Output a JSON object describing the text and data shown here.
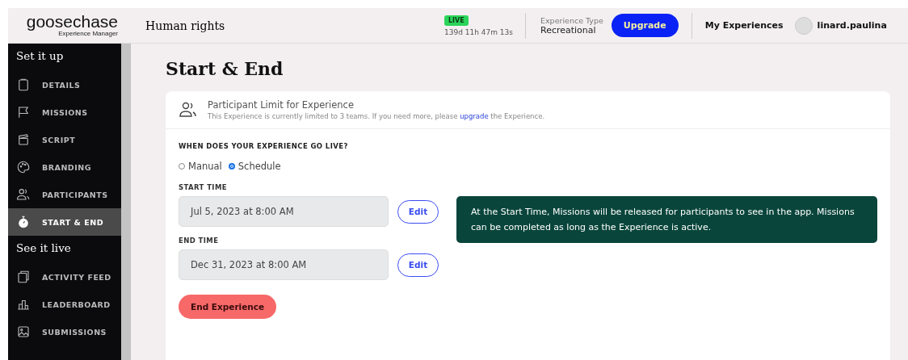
{
  "header": {
    "logo": "goosechase",
    "logo_subtitle": "Experience Manager",
    "experience_name": "Human rights",
    "status_badge": "LIVE",
    "countdown": "139d 11h 47m 13s",
    "type_label": "Experience Type",
    "type_value": "Recreational",
    "upgrade_button": "Upgrade",
    "my_experiences": "My Experiences",
    "username": "linard.paulina"
  },
  "sidebar": {
    "sections": [
      {
        "heading": "Set it up",
        "items": [
          {
            "label": "DETAILS",
            "kind": "clipboard",
            "selected": false
          },
          {
            "label": "MISSIONS",
            "kind": "flag",
            "selected": false
          },
          {
            "label": "SCRIPT",
            "kind": "clapper",
            "selected": false
          },
          {
            "label": "BRANDING",
            "kind": "palette",
            "selected": false
          },
          {
            "label": "PARTICIPANTS",
            "kind": "people",
            "selected": false
          },
          {
            "label": "START & END",
            "kind": "stopwatch",
            "selected": true
          }
        ]
      },
      {
        "heading": "See it live",
        "items": [
          {
            "label": "ACTIVITY FEED",
            "kind": "feed",
            "selected": false
          },
          {
            "label": "LEADERBOARD",
            "kind": "chart",
            "selected": false
          },
          {
            "label": "SUBMISSIONS",
            "kind": "image",
            "selected": false
          }
        ]
      }
    ]
  },
  "page_title": "Start & End",
  "notice": {
    "title": "Participant Limit for Experience",
    "text_before": "This Experience is currently limited to 3 teams. If you need more, please",
    "link": "upgrade",
    "text_after": "the Experience."
  },
  "go_live": {
    "question": "WHEN DOES YOUR EXPERIENCE GO LIVE?",
    "options": [
      {
        "label": "Manual",
        "selected": false
      },
      {
        "label": "Schedule",
        "selected": true
      }
    ]
  },
  "times": [
    {
      "label": "START TIME",
      "value": "Jul 5, 2023 at 8:00 AM",
      "button": "Edit"
    },
    {
      "label": "END TIME",
      "value": "Dec 31, 2023 at 8:00 AM",
      "button": "Edit"
    }
  ],
  "info": "At the Start Time, Missions will be released for participants to see in the app. Missions can be completed as long as the Experience is active.",
  "end_button": "End Experience"
}
